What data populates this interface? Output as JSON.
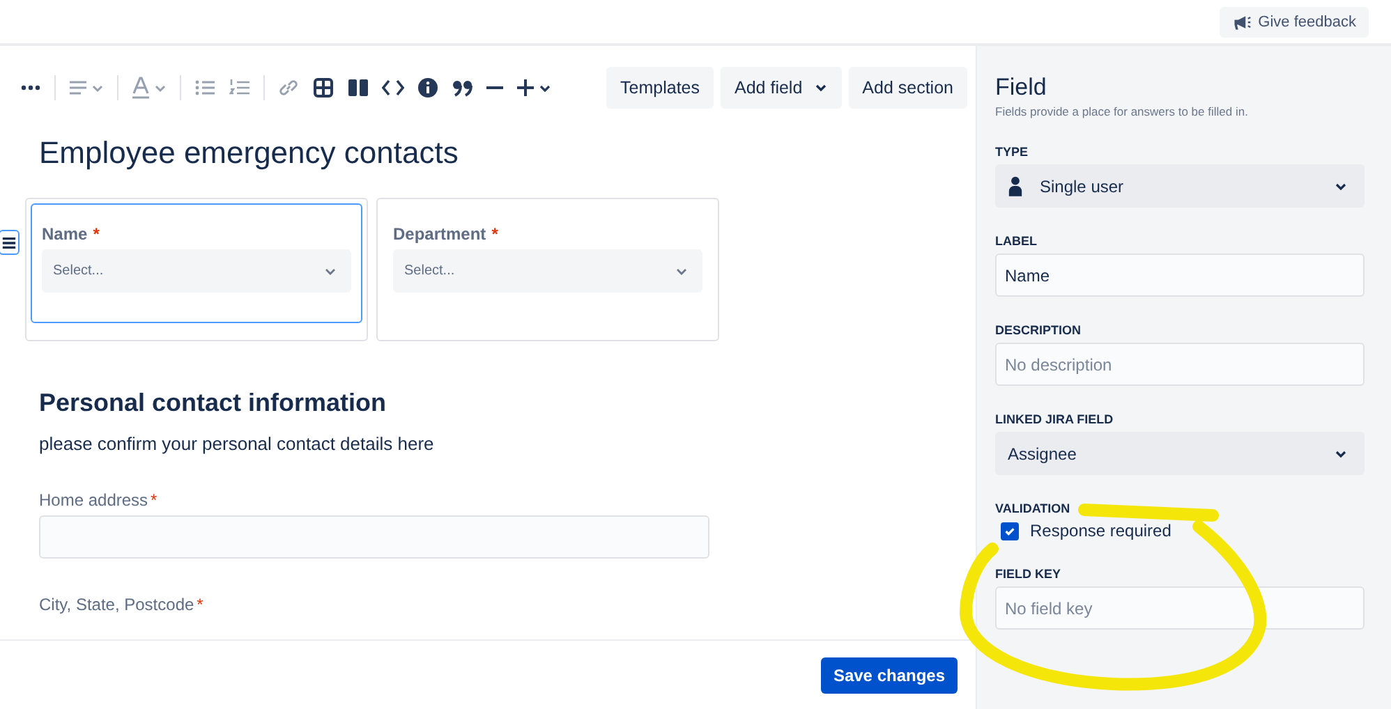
{
  "top_bar": {
    "feedback_button": "Give feedback"
  },
  "toolbar": {
    "tools": [
      {
        "kind": "more",
        "disabled": false
      },
      {
        "kind": "align",
        "disabled": true
      },
      {
        "kind": "text-color",
        "disabled": true
      },
      {
        "kind": "bullets",
        "disabled": true
      },
      {
        "kind": "numbers",
        "disabled": true
      },
      {
        "kind": "link",
        "disabled": true
      },
      {
        "kind": "table",
        "disabled": false
      },
      {
        "kind": "layout",
        "disabled": false
      },
      {
        "kind": "code",
        "disabled": false
      },
      {
        "kind": "info",
        "disabled": false
      },
      {
        "kind": "quote",
        "disabled": false
      },
      {
        "kind": "divider",
        "disabled": false
      },
      {
        "kind": "insert",
        "disabled": false
      }
    ],
    "buttons": [
      {
        "label": "Templates",
        "dropdown": false
      },
      {
        "label": "Add field",
        "dropdown": true
      },
      {
        "label": "Add section",
        "dropdown": false
      }
    ]
  },
  "form": {
    "title": "Employee emergency contacts",
    "field_cards": [
      {
        "label": "Name",
        "required_mark": "*",
        "placeholder": "Select...",
        "selected": true
      },
      {
        "label": "Department",
        "required_mark": "*",
        "placeholder": "Select...",
        "selected": false
      }
    ],
    "section": {
      "heading": "Personal contact information",
      "description": "please confirm your personal contact details here"
    },
    "fields": [
      {
        "label": "Home address",
        "required_mark": "*"
      },
      {
        "label": "City, State, Postcode",
        "required_mark": "*"
      }
    ]
  },
  "footer": {
    "save_button": "Save changes"
  },
  "panel": {
    "title": "Field",
    "subtitle": "Fields provide a place for answers to be filled in.",
    "type": {
      "label": "TYPE",
      "value": "Single user"
    },
    "label_field": {
      "label": "LABEL",
      "value": "Name"
    },
    "description_field": {
      "label": "DESCRIPTION",
      "placeholder": "No description"
    },
    "linked_field": {
      "label": "LINKED JIRA FIELD",
      "value": "Assignee"
    },
    "validation": {
      "label": "VALIDATION",
      "option": "Response required",
      "checked": true
    },
    "field_key": {
      "label": "FIELD KEY",
      "placeholder": "No field key"
    }
  }
}
